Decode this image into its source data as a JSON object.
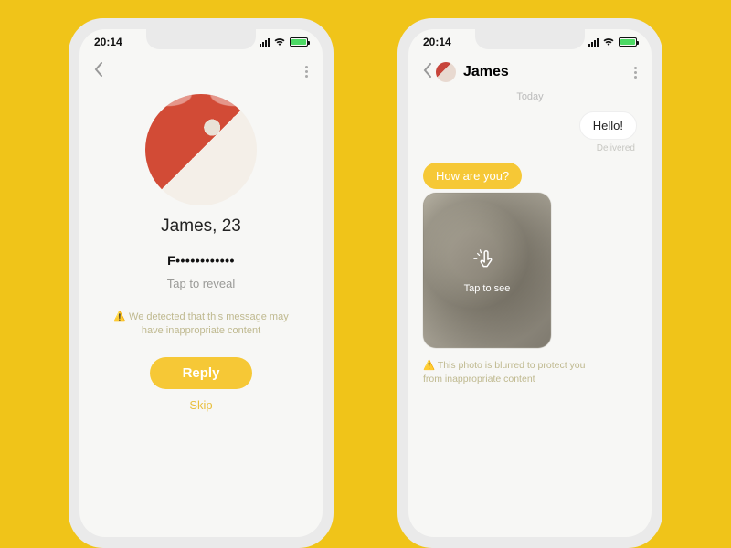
{
  "status": {
    "time": "20:14"
  },
  "left": {
    "name_age": "James, 23",
    "masked_message": "F••••••••••••",
    "tap_reveal": "Tap to reveal",
    "warning": "⚠️ We detected that this message may have inappropriate content",
    "reply": "Reply",
    "skip": "Skip"
  },
  "right": {
    "title": "James",
    "day": "Today",
    "msg_out": "Hello!",
    "delivered": "Delivered",
    "msg_in": "How are you?",
    "tap_to_see": "Tap to see",
    "warning": "⚠️ This photo is blurred to protect you from inappropriate content"
  }
}
